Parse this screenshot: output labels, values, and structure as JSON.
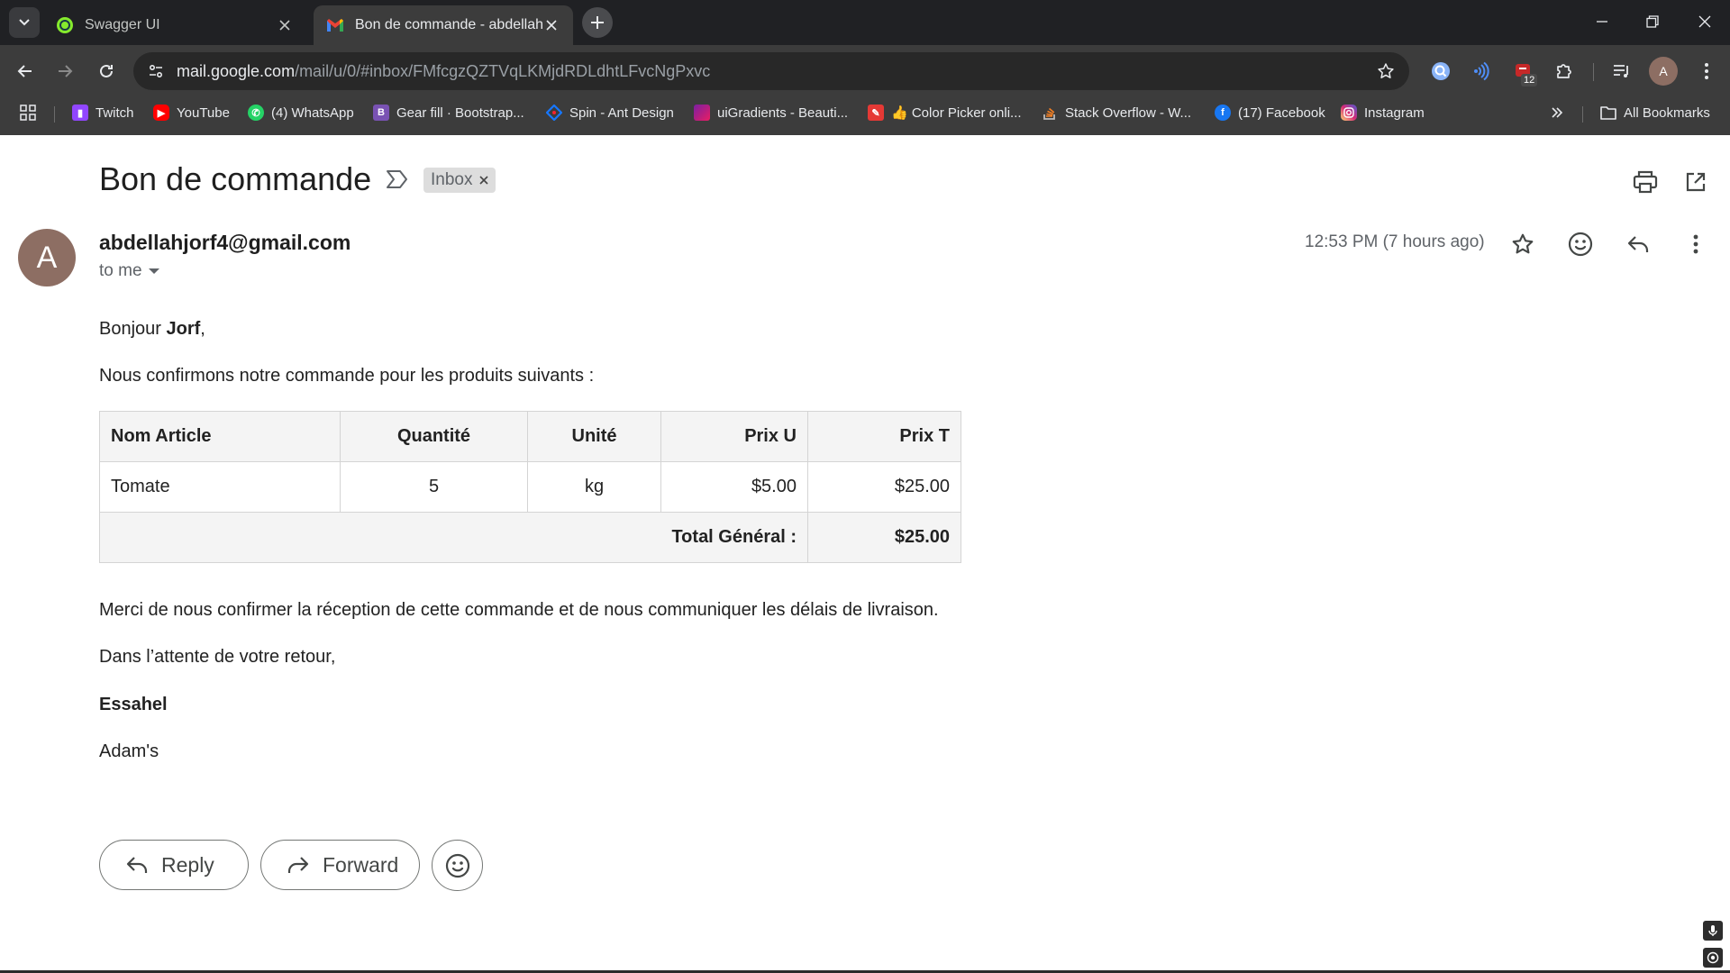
{
  "browser": {
    "tabs": [
      {
        "title": "Swagger UI",
        "active": false,
        "icon": "swagger-icon"
      },
      {
        "title": "Bon de commande - abdellahjo",
        "active": true,
        "icon": "gmail-icon"
      }
    ],
    "url_host": "mail.google.com",
    "url_path": "/mail/u/0/#inbox/FMfcgzQZTVqLKMjdRDLdhtLFvcNgPxvc",
    "extension_badge": "12",
    "profile_initial": "A",
    "bookmarks": [
      {
        "label": "Twitch",
        "icon": "twitch-icon",
        "color": "#9146ff"
      },
      {
        "label": "YouTube",
        "icon": "youtube-icon",
        "color": "#ff0000"
      },
      {
        "label": "(4) WhatsApp",
        "icon": "whatsapp-icon",
        "color": "#25d366"
      },
      {
        "label": "Gear fill · Bootstrap...",
        "icon": "bootstrap-icon",
        "color": "#7952b3"
      },
      {
        "label": "Spin - Ant Design",
        "icon": "antdesign-icon",
        "color": "#1677ff"
      },
      {
        "label": "uiGradients - Beauti...",
        "icon": "uigradients-icon",
        "color": "#c2185b"
      },
      {
        "label": "👍 Color Picker onli...",
        "icon": "colorpicker-icon",
        "color": "#e53935"
      },
      {
        "label": "Stack Overflow - W...",
        "icon": "stackoverflow-icon",
        "color": "#f48024"
      },
      {
        "label": "(17) Facebook",
        "icon": "facebook-icon",
        "color": "#1877f2"
      },
      {
        "label": "Instagram",
        "icon": "instagram-icon",
        "color": "#d62976"
      }
    ],
    "all_bookmarks": "All Bookmarks"
  },
  "email": {
    "subject": "Bon de commande",
    "label": "Inbox",
    "sender_initial": "A",
    "sender": "abdellahjorf4@gmail.com",
    "recipient": "to me",
    "date": "12:53 PM (7 hours ago)",
    "greeting_prefix": "Bonjour ",
    "greeting_name": "Jorf",
    "greeting_suffix": ",",
    "intro": "Nous confirmons notre commande pour les produits suivants :",
    "table": {
      "headers": [
        "Nom Article",
        "Quantité",
        "Unité",
        "Prix U",
        "Prix T"
      ],
      "rows": [
        [
          "Tomate",
          "5",
          "kg",
          "$5.00",
          "$25.00"
        ]
      ],
      "total_label": "Total Général :",
      "total_value": "$25.00"
    },
    "closing_request": "Merci de nous confirmer la réception de cette commande et de nous communiquer les délais de livraison.",
    "sign_off": "Dans l’attente de votre retour,",
    "signature_name": "Essahel",
    "signature_company": "Adam's"
  },
  "actions": {
    "reply": "Reply",
    "forward": "Forward"
  },
  "colors": {
    "avatar": "#8d6e63",
    "chrome_dark": "#202124",
    "toolbar": "#3c3c3c"
  }
}
